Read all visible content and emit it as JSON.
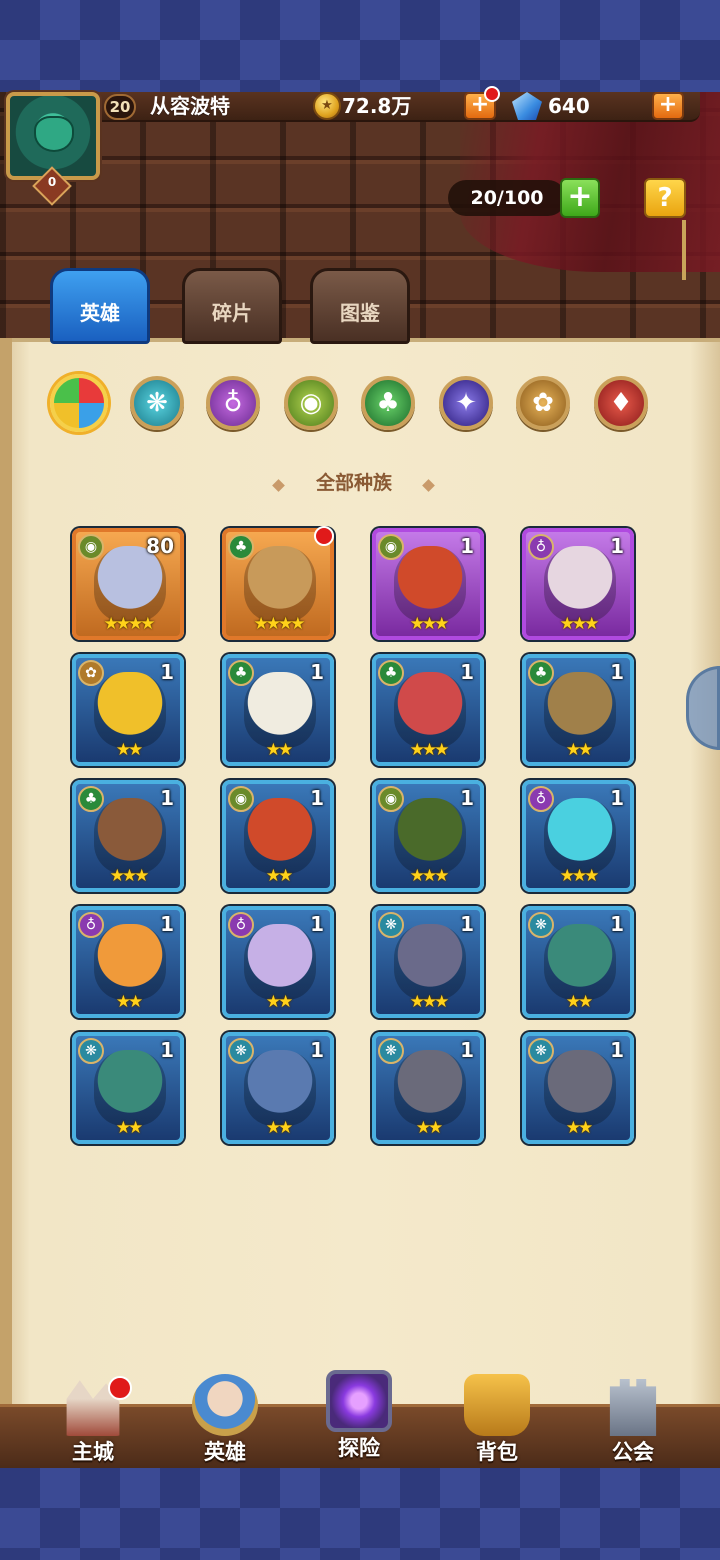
{
  "header": {
    "player_level": "20",
    "player_name": "从容波特",
    "avatar_badge": "0",
    "gold": "72.8万",
    "gems": "640",
    "plus": "+",
    "capacity": "20/100",
    "help": "?"
  },
  "tabs": [
    {
      "label": "英雄",
      "active": true
    },
    {
      "label": "碎片",
      "active": false
    },
    {
      "label": "图鉴",
      "active": false
    }
  ],
  "race_filters": [
    {
      "name": "all-races",
      "selected": true
    },
    {
      "name": "race-cyan-icon"
    },
    {
      "name": "race-purple-icon"
    },
    {
      "name": "race-olive-icon"
    },
    {
      "name": "race-green-icon"
    },
    {
      "name": "race-dark-icon"
    },
    {
      "name": "race-gold-icon"
    },
    {
      "name": "race-red-icon"
    }
  ],
  "section_title": "全部种族",
  "heroes": [
    {
      "level": "80",
      "stars": "★★★★",
      "frame": "orange",
      "race": "olive",
      "portrait": "#b8c0e0"
    },
    {
      "level": "",
      "stars": "★★★★",
      "frame": "orange",
      "race": "green",
      "portrait": "#c89a5a",
      "alert": true
    },
    {
      "level": "1",
      "stars": "★★★",
      "frame": "purple",
      "race": "olive",
      "portrait": "#d04a2a"
    },
    {
      "level": "1",
      "stars": "★★★",
      "frame": "purple",
      "race": "purple",
      "portrait": "#e6d6e0"
    },
    {
      "level": "1",
      "stars": "★★",
      "frame": "blue",
      "race": "gold",
      "portrait": "#f0c02a"
    },
    {
      "level": "1",
      "stars": "★★",
      "frame": "blue",
      "race": "green",
      "portrait": "#f0ece0"
    },
    {
      "level": "1",
      "stars": "★★★",
      "frame": "blue",
      "race": "green",
      "portrait": "#d04a4a"
    },
    {
      "level": "1",
      "stars": "★★",
      "frame": "blue",
      "race": "green",
      "portrait": "#a0804a"
    },
    {
      "level": "1",
      "stars": "★★★",
      "frame": "blue",
      "race": "green",
      "portrait": "#8a5a3a"
    },
    {
      "level": "1",
      "stars": "★★",
      "frame": "blue",
      "race": "olive",
      "portrait": "#d04a2a"
    },
    {
      "level": "1",
      "stars": "★★★",
      "frame": "blue",
      "race": "olive",
      "portrait": "#4a6a2a"
    },
    {
      "level": "1",
      "stars": "★★★",
      "frame": "blue",
      "race": "purple",
      "portrait": "#4ad0e0"
    },
    {
      "level": "1",
      "stars": "★★",
      "frame": "blue",
      "race": "purple",
      "portrait": "#f09a3a"
    },
    {
      "level": "1",
      "stars": "★★",
      "frame": "blue",
      "race": "purple",
      "portrait": "#c6b0e6"
    },
    {
      "level": "1",
      "stars": "★★★",
      "frame": "blue",
      "race": "cyan",
      "portrait": "#6a6a8a"
    },
    {
      "level": "1",
      "stars": "★★",
      "frame": "blue",
      "race": "cyan",
      "portrait": "#3a8a7a"
    },
    {
      "level": "1",
      "stars": "★★",
      "frame": "blue",
      "race": "cyan",
      "portrait": "#3a8a7a"
    },
    {
      "level": "1",
      "stars": "★★",
      "frame": "blue",
      "race": "cyan",
      "portrait": "#5a7ab0"
    },
    {
      "level": "1",
      "stars": "★★",
      "frame": "blue",
      "race": "cyan",
      "portrait": "#6a6a7a"
    },
    {
      "level": "1",
      "stars": "★★",
      "frame": "blue",
      "race": "cyan",
      "portrait": "#6a6a7a"
    }
  ],
  "nav": [
    {
      "label": "主城",
      "alert": true
    },
    {
      "label": "英雄"
    },
    {
      "label": "探险"
    },
    {
      "label": "背包"
    },
    {
      "label": "公会"
    }
  ],
  "colors": {
    "tab_active": "#1a60c0",
    "parchment": "#f4e9cb",
    "star": "#ffd21a",
    "alert": "#e01a1a"
  }
}
